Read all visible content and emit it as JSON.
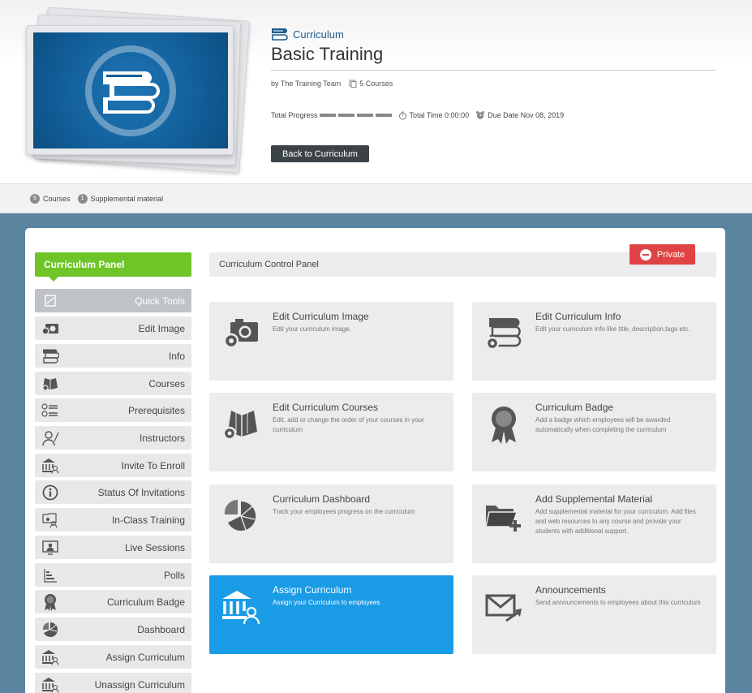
{
  "header": {
    "breadcrumb": "Curriculum",
    "title": "Basic Training",
    "author": "by The Training Team",
    "course_count": "5 Courses",
    "progress_label": "Total Progress",
    "total_time": "Total Time 0:00:00",
    "due_date": "Due Date Nov 08, 2019",
    "back_button": "Back to Curriculum"
  },
  "subbar": {
    "courses_count": "5",
    "courses_label": "Courses",
    "supplemental_count": "1",
    "supplemental_label": "Supplemental material"
  },
  "sidebar": {
    "title": "Curriculum Panel",
    "items": [
      {
        "label": "Quick Tools",
        "icon": "quick-tools-icon"
      },
      {
        "label": "Edit Image",
        "icon": "camera-gear-icon"
      },
      {
        "label": "Info",
        "icon": "books-icon"
      },
      {
        "label": "Courses",
        "icon": "open-book-icon"
      },
      {
        "label": "Prerequisites",
        "icon": "checklist-icon"
      },
      {
        "label": "Instructors",
        "icon": "instructor-icon"
      },
      {
        "label": "Invite To Enroll",
        "icon": "institution-user-icon"
      },
      {
        "label": "Status Of Invitations",
        "icon": "info-icon"
      },
      {
        "label": "In-Class Training",
        "icon": "classroom-icon"
      },
      {
        "label": "Live Sessions",
        "icon": "live-screen-icon"
      },
      {
        "label": "Polls",
        "icon": "poll-bars-icon"
      },
      {
        "label": "Curriculum Badge",
        "icon": "badge-icon"
      },
      {
        "label": "Dashboard",
        "icon": "pie-chart-icon"
      },
      {
        "label": "Assign Curriculum",
        "icon": "assign-icon"
      },
      {
        "label": "Unassign Curriculum",
        "icon": "unassign-icon"
      }
    ]
  },
  "control_panel": {
    "title": "Curriculum Control Panel",
    "private_label": "Private",
    "tiles": [
      {
        "title": "Edit Curriculum Image",
        "desc": "Edit your curriculum image."
      },
      {
        "title": "Edit Curriculum Info",
        "desc": "Edit your curriculum info like title, description,tags etc."
      },
      {
        "title": "Edit Curriculum Courses",
        "desc": "Edit, add or change the order of your courses in your curriculum"
      },
      {
        "title": "Curriculum Badge",
        "desc": "Add a badge which employees will be awarded automatically when completing the curriculum"
      },
      {
        "title": "Curriculum Dashboard",
        "desc": "Track your employees progress on the curriculum"
      },
      {
        "title": "Add Supplemental Material",
        "desc": "Add supplemental material for your curriculum. Add files and web resources to any course and provide your students with additional support."
      },
      {
        "title": "Assign Curriculum",
        "desc": "Assign your Curriculum to employees"
      },
      {
        "title": "Announcements",
        "desc": "Send announcements to employees about this curriculum"
      }
    ]
  },
  "colors": {
    "accent_green": "#6fc528",
    "accent_blue": "#1a9be6",
    "private_red": "#e04343",
    "page_bg": "#5b84a1"
  }
}
